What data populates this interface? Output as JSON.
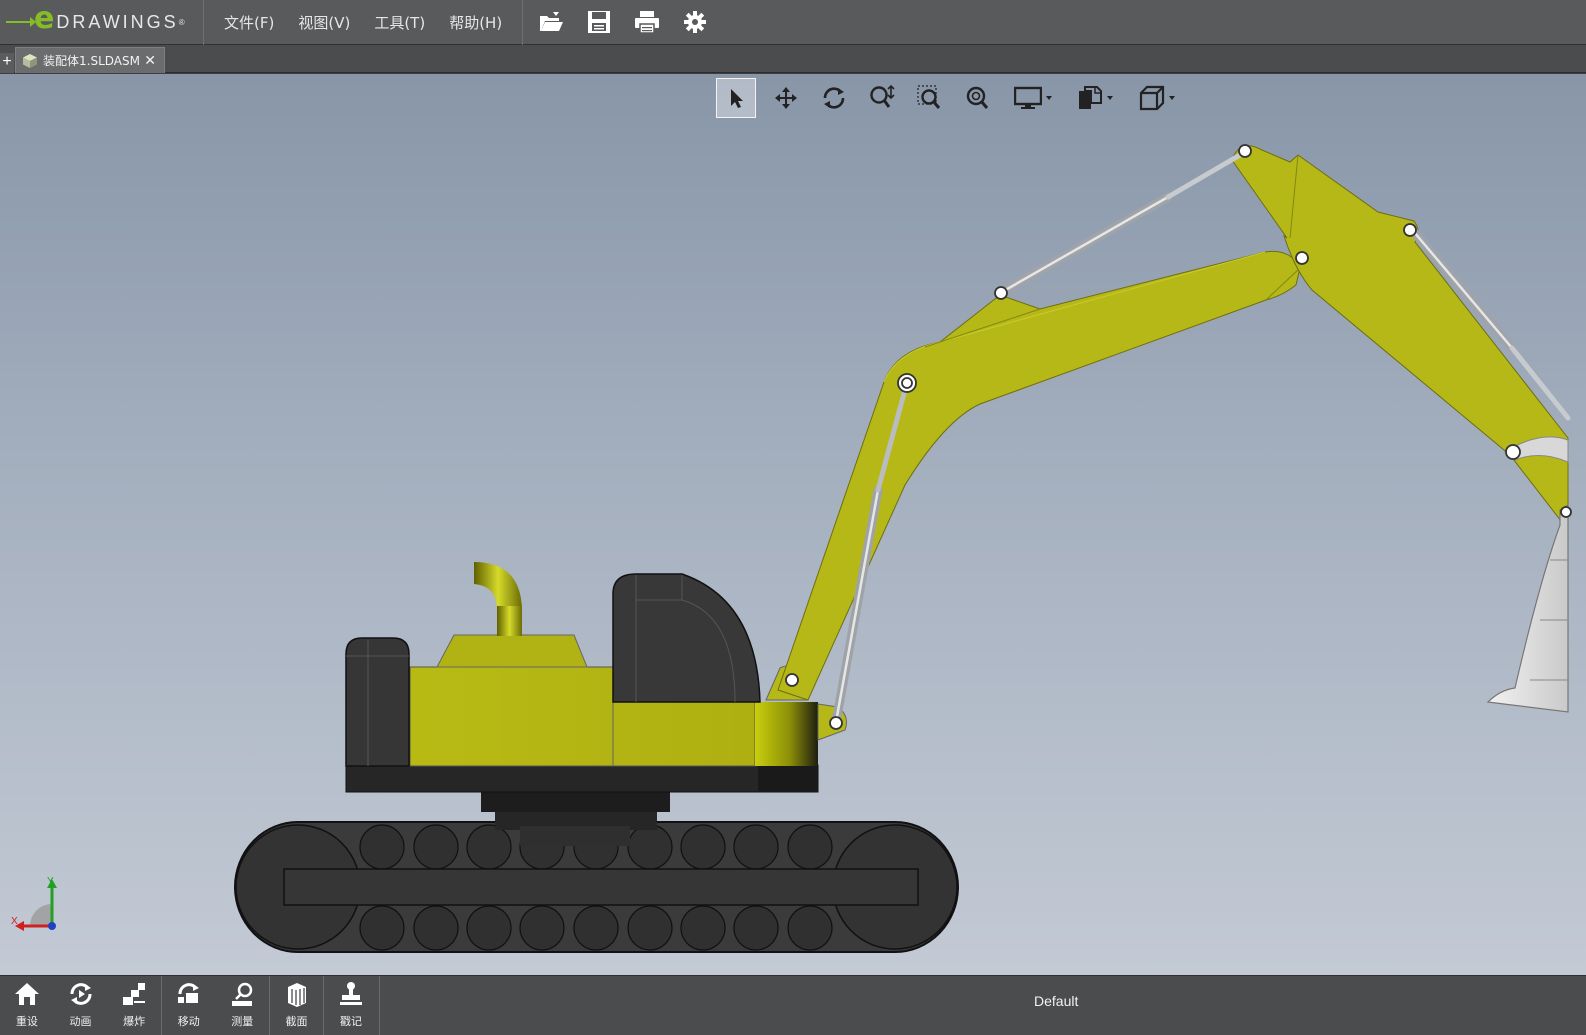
{
  "app": {
    "logo_letter": "e",
    "logo_word": "DRAWINGS",
    "logo_mark": "®"
  },
  "menu": {
    "items": [
      {
        "label": "文件(F)"
      },
      {
        "label": "视图(V)"
      },
      {
        "label": "工具(T)"
      },
      {
        "label": "帮助(H)"
      }
    ]
  },
  "toolbar": {
    "icons": [
      "open-folder-icon",
      "save-icon",
      "print-icon",
      "gear-icon"
    ]
  },
  "tabs": {
    "add_label": "+",
    "document": {
      "label": "装配体1.SLDASM",
      "close": "✕",
      "icon": "assembly-icon"
    }
  },
  "hud": {
    "icons": [
      "select-arrow-icon",
      "pan-icon",
      "rotate-icon",
      "zoom-fit-icon",
      "zoom-area-icon",
      "zoom-in-out-icon",
      "display-style-icon",
      "sheet-view-icon",
      "view-orientation-icon"
    ]
  },
  "triad": {
    "x_label": "X",
    "y_label": "Y"
  },
  "bottom": {
    "buttons": [
      {
        "label": "重设",
        "icon": "home-icon"
      },
      {
        "label": "动画",
        "icon": "animate-icon"
      },
      {
        "label": "爆炸",
        "icon": "explode-icon"
      },
      {
        "label": "移动",
        "icon": "move-icon"
      },
      {
        "label": "测量",
        "icon": "measure-icon"
      },
      {
        "label": "截面",
        "icon": "section-icon"
      },
      {
        "label": "戳记",
        "icon": "stamp-icon"
      }
    ],
    "configuration": "Default"
  },
  "colors": {
    "body_yellow": "#b5b817",
    "dark_body": "#363636",
    "accent_green": "#86bc25"
  }
}
